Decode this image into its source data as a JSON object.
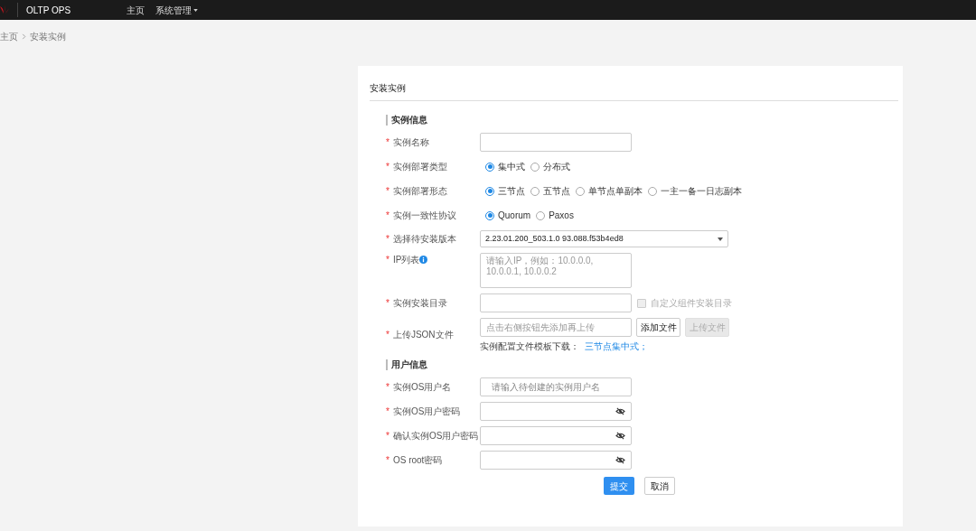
{
  "header": {
    "brand": "OLTP OPS",
    "nav": [
      {
        "label": "主页",
        "dropdown": false
      },
      {
        "label": "系统管理",
        "dropdown": true
      }
    ]
  },
  "breadcrumb": [
    "主页",
    "安装实例"
  ],
  "card": {
    "title": "安装实例",
    "sections": [
      {
        "title": "实例信息",
        "fields": [
          {
            "kind": "text",
            "mark": "*",
            "label": "实例名称"
          },
          {
            "kind": "radio",
            "mark": "*",
            "label": "实例部署类型",
            "options": [
              {
                "label": "集中式",
                "selected": true
              },
              {
                "label": "分布式",
                "selected": false
              }
            ]
          },
          {
            "kind": "radio",
            "mark": "*",
            "label": "实例部署形态",
            "options": [
              {
                "label": "三节点",
                "selected": true
              },
              {
                "label": "五节点",
                "selected": false
              },
              {
                "label": "单节点单副本",
                "selected": false
              },
              {
                "label": "一主一备一日志副本",
                "selected": false
              }
            ]
          },
          {
            "kind": "radio",
            "mark": "*",
            "label": "实例一致性协议",
            "options": [
              {
                "label": "Quorum",
                "selected": true
              },
              {
                "label": "Paxos",
                "selected": false
              }
            ]
          },
          {
            "kind": "select",
            "mark": "*",
            "label": "选择待安装版本",
            "value": "2.23.01.200_503.1.0 93.088.f53b4ed8"
          },
          {
            "kind": "textarea",
            "mark": "*",
            "label": "IP列表",
            "info": true,
            "placeholder": "请输入IP，例如：10.0.0.0, 10.0.0.1, 10.0.0.2"
          },
          {
            "kind": "text",
            "mark": "*",
            "label": "实例安装目录",
            "checkbox": {
              "label": "自定义组件安装目录",
              "checked": false,
              "disabled": true
            }
          },
          {
            "kind": "file",
            "mark": "*",
            "label": "上传JSON文件",
            "placeholder": "点击右侧按钮先添加再上传",
            "buttons": [
              {
                "label": "添加文件",
                "disabled": false
              },
              {
                "label": "上传文件",
                "disabled": true
              }
            ],
            "hint": "实例配置文件模板下载：",
            "link": "三节点集中式；"
          }
        ]
      },
      {
        "title": "用户信息",
        "fields": [
          {
            "kind": "text",
            "mark": "*",
            "label": "实例OS用户名",
            "placeholder": "请输入待创建的实例用户名"
          },
          {
            "kind": "password",
            "mark": "*",
            "label": "实例OS用户密码"
          },
          {
            "kind": "password",
            "mark": "*",
            "label": "确认实例OS用户密码"
          },
          {
            "kind": "password",
            "mark": "*",
            "label": "OS root密码"
          }
        ]
      }
    ],
    "actions": [
      {
        "label": "提交",
        "primary": true
      },
      {
        "label": "取消",
        "primary": false
      }
    ]
  }
}
